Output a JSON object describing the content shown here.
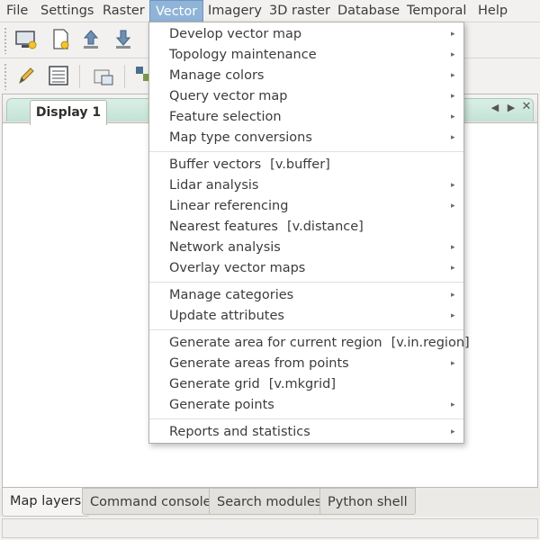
{
  "menubar": {
    "items": [
      "File",
      "Settings",
      "Raster",
      "Vector",
      "Imagery",
      "3D raster",
      "Database",
      "Temporal",
      "Help"
    ],
    "active": "Vector"
  },
  "toolbar1": {
    "icons": [
      "new-display-icon",
      "new-workspace-icon",
      "open-workspace-icon",
      "save-workspace-icon"
    ]
  },
  "toolbar2": {
    "icons": [
      "edit-icon",
      "attribute-table-icon",
      "layer-manager-icon",
      "georectify-icon"
    ]
  },
  "display": {
    "tab_label": "Display 1"
  },
  "vector_menu": {
    "items": [
      {
        "label": "Develop vector map",
        "cmd": "",
        "submenu": true
      },
      {
        "label": "Topology maintenance",
        "cmd": "",
        "submenu": true
      },
      {
        "label": "Manage colors",
        "cmd": "",
        "submenu": true
      },
      {
        "label": "Query vector map",
        "cmd": "",
        "submenu": true
      },
      {
        "label": "Feature selection",
        "cmd": "",
        "submenu": true
      },
      {
        "label": "Map type conversions",
        "cmd": "",
        "submenu": true
      },
      {
        "label": "Buffer vectors",
        "cmd": "[v.buffer]",
        "submenu": false
      },
      {
        "label": "Lidar analysis",
        "cmd": "",
        "submenu": true
      },
      {
        "label": "Linear referencing",
        "cmd": "",
        "submenu": true
      },
      {
        "label": "Nearest features",
        "cmd": "[v.distance]",
        "submenu": false
      },
      {
        "label": "Network analysis",
        "cmd": "",
        "submenu": true
      },
      {
        "label": "Overlay vector maps",
        "cmd": "",
        "submenu": true
      },
      {
        "label": "Manage categories",
        "cmd": "",
        "submenu": true
      },
      {
        "label": "Update attributes",
        "cmd": "",
        "submenu": true
      },
      {
        "label": "Generate area for current region",
        "cmd": "[v.in.region]",
        "submenu": false
      },
      {
        "label": "Generate areas from points",
        "cmd": "",
        "submenu": true
      },
      {
        "label": "Generate grid",
        "cmd": "[v.mkgrid]",
        "submenu": false
      },
      {
        "label": "Generate points",
        "cmd": "",
        "submenu": true
      },
      {
        "label": "Reports and statistics",
        "cmd": "",
        "submenu": true
      }
    ]
  },
  "bottom_tabs": {
    "items": [
      "Map layers",
      "Command console",
      "Search modules",
      "Python shell"
    ],
    "active": "Map layers"
  },
  "colors": {
    "menu_highlight": "#8fb4d8",
    "display_tab_accent": "#c4e2d6"
  }
}
